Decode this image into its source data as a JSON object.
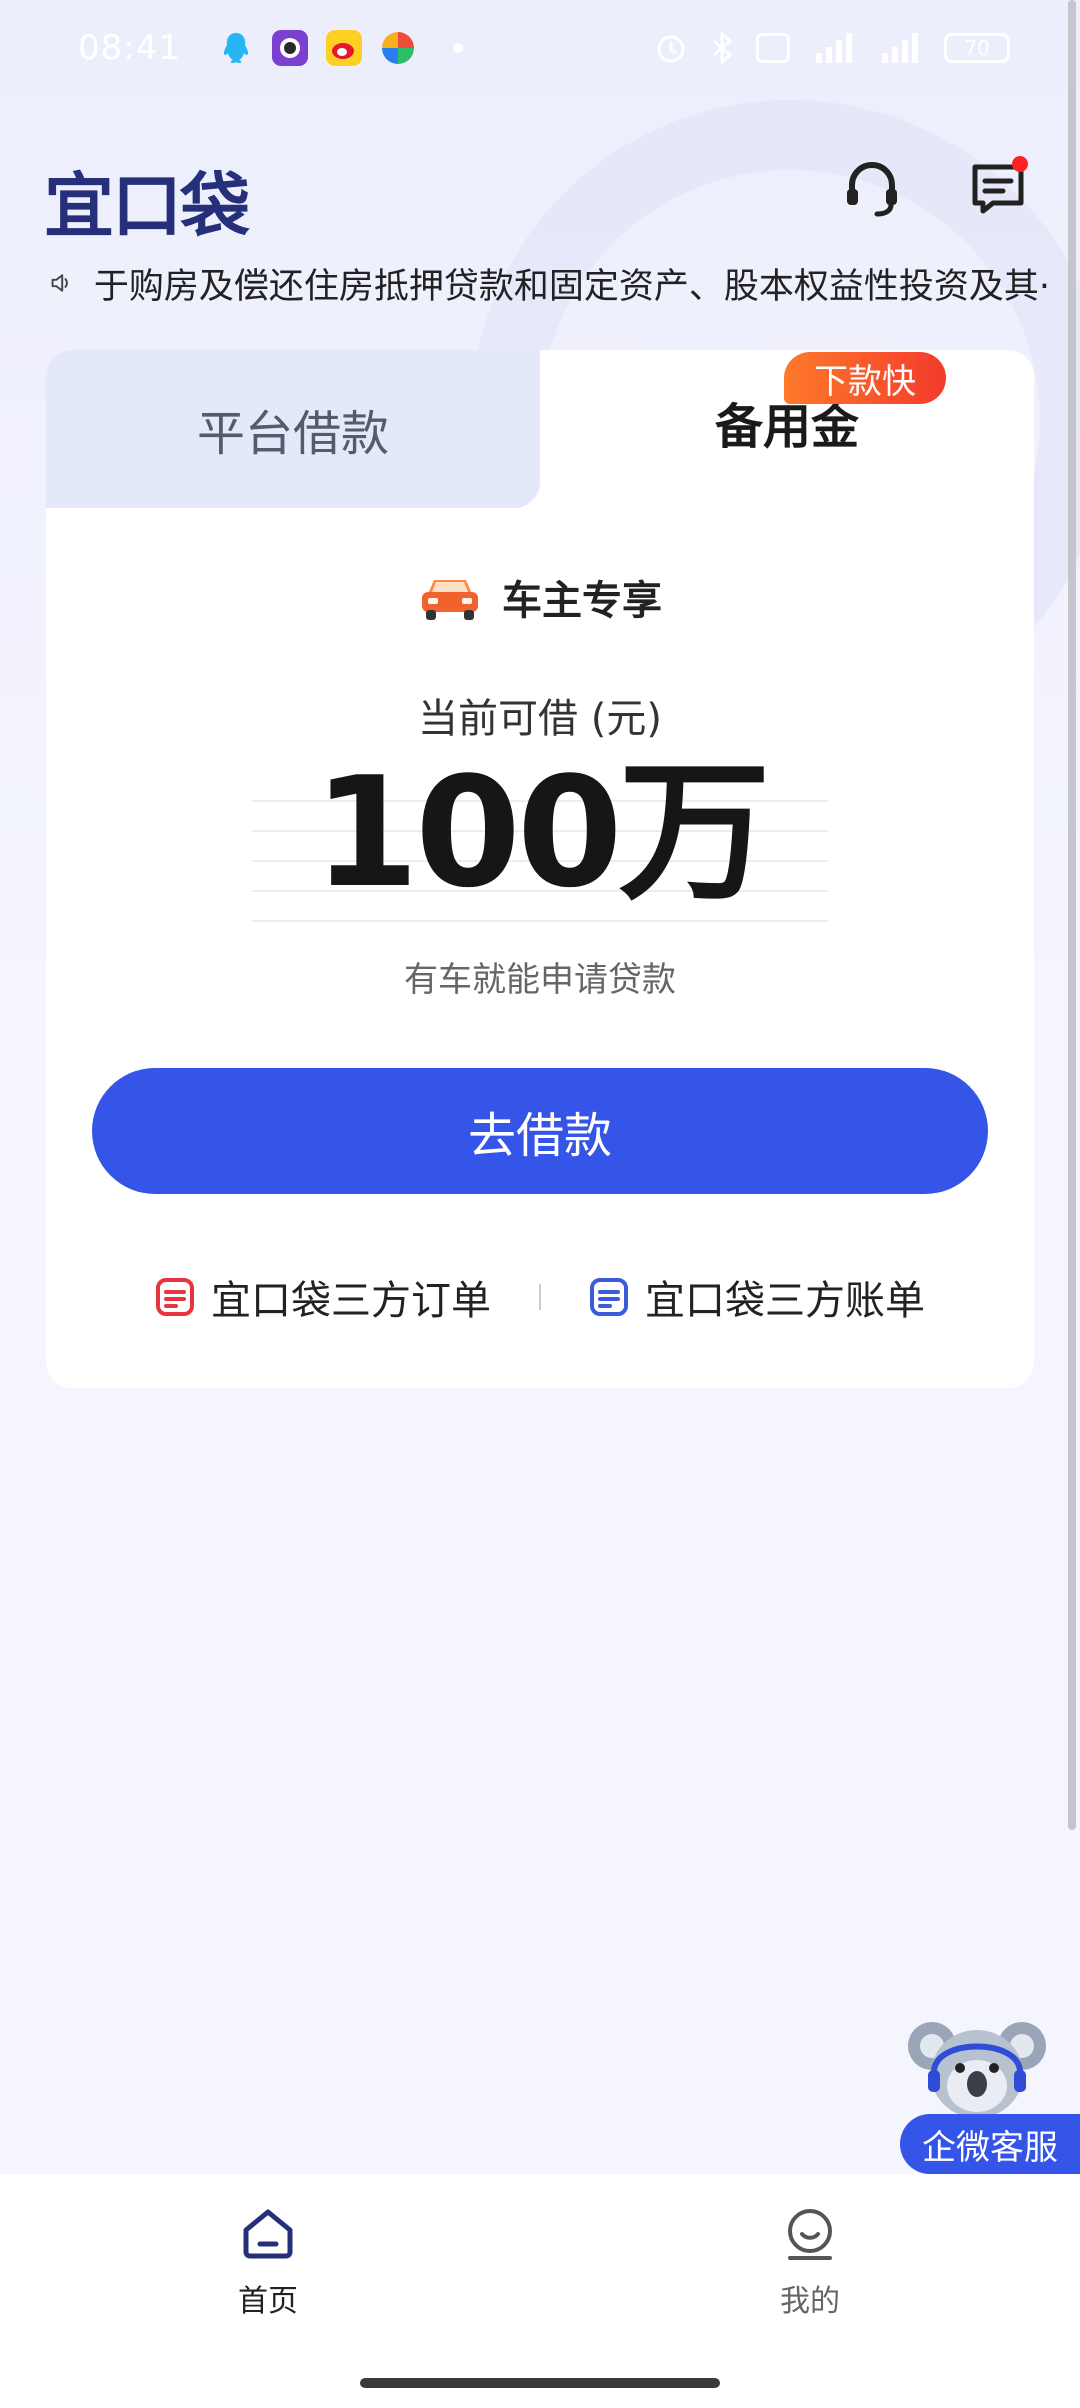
{
  "status_bar": {
    "time": "08:41",
    "battery": "70"
  },
  "header": {
    "logo": "宜口袋",
    "support_icon": "headset-icon",
    "message_icon": "message-icon"
  },
  "notice": {
    "icon": "speaker-icon",
    "text": "于购房及偿还住房抵押贷款和固定资产、股本权益性投资及其·"
  },
  "card": {
    "tabs": [
      {
        "label": "平台借款",
        "active": false
      },
      {
        "label": "备用金",
        "active": true
      }
    ],
    "badge": "下款快",
    "exclusive": "车主专享",
    "available_label": "当前可借 (元)",
    "amount": "100万",
    "hint": "有车就能申请贷款",
    "cta": "去借款",
    "links": [
      {
        "label": "宜口袋三方订单",
        "icon": "order-icon",
        "color": "#e8343d"
      },
      {
        "label": "宜口袋三方账单",
        "icon": "bill-icon",
        "color": "#3a5bdc"
      }
    ]
  },
  "floating": {
    "label": "企微客服"
  },
  "bottom_nav": [
    {
      "label": "首页",
      "icon": "home-icon",
      "active": true
    },
    {
      "label": "我的",
      "icon": "profile-icon",
      "active": false
    }
  ],
  "colors": {
    "primary": "#3554e8",
    "logo": "#26307a",
    "badge": "#f23b2c"
  }
}
